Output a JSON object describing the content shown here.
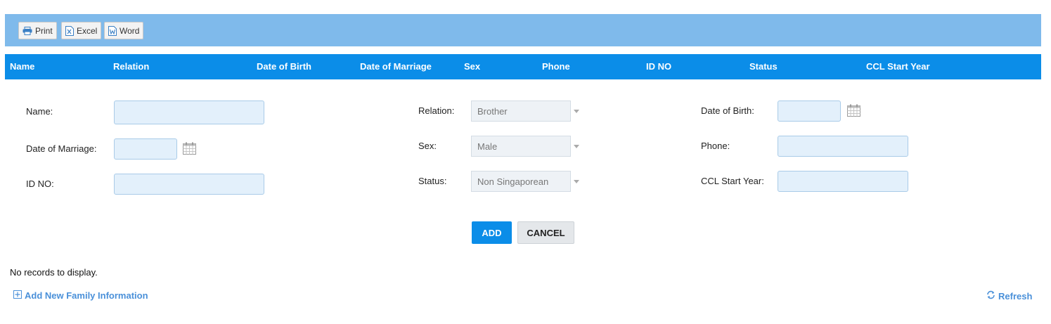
{
  "toolbar": {
    "print_label": "Print",
    "excel_label": "Excel",
    "word_label": "Word"
  },
  "grid": {
    "columns": [
      "Name",
      "Relation",
      "Date of Birth",
      "Date of Marriage",
      "Sex",
      "Phone",
      "ID NO",
      "Status",
      "CCL Start Year"
    ],
    "empty_message": "No records to display."
  },
  "form": {
    "name_label": "Name:",
    "name_value": "",
    "date_of_marriage_label": "Date of Marriage:",
    "date_of_marriage_value": "",
    "id_no_label": "ID NO:",
    "id_no_value": "",
    "relation_label": "Relation:",
    "relation_value": "Brother",
    "sex_label": "Sex:",
    "sex_value": "Male",
    "status_label": "Status:",
    "status_value": "Non Singaporean",
    "date_of_birth_label": "Date of Birth:",
    "date_of_birth_value": "",
    "phone_label": "Phone:",
    "phone_value": "",
    "ccl_start_year_label": "CCL Start Year:",
    "ccl_start_year_value": "",
    "add_label": "ADD",
    "cancel_label": "CANCEL"
  },
  "footer": {
    "add_new_label": "Add New Family Information",
    "refresh_label": "Refresh"
  },
  "colors": {
    "toolbar_bg": "#7fbaeb",
    "header_bg": "#0b8de8",
    "link": "#4a90d9"
  }
}
